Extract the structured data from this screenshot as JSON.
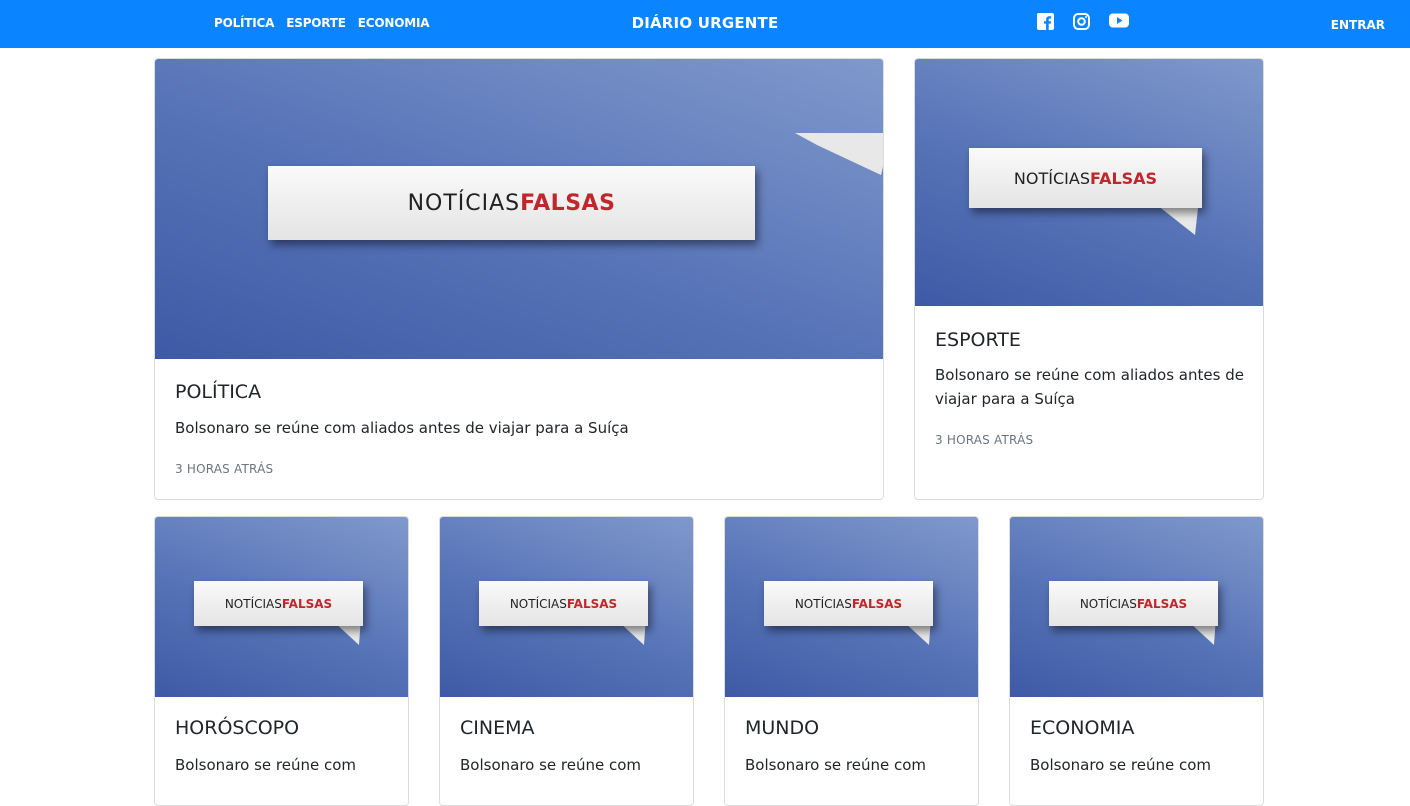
{
  "nav": {
    "links": [
      "POLÍTICA",
      "ESPORTE",
      "ECONOMIA"
    ],
    "brand": "DIÁRIO URGENTE",
    "social": [
      "facebook-icon",
      "instagram-icon",
      "youtube-icon"
    ],
    "login": "ENTRAR"
  },
  "image_text": {
    "part1": "NOTÍCIAS",
    "part2": "FALSAS"
  },
  "colors": {
    "navbar": "#0a85ff",
    "falsas": "#c0272d",
    "card_image_blue": "#4f6db5"
  },
  "cards": [
    {
      "title": "POLÍTICA",
      "text": "Bolsonaro se reúne com aliados antes de viajar para a Suíça",
      "time": "3 HORAS ATRÁS"
    },
    {
      "title": "ESPORTE",
      "text": "Bolsonaro se reúne com aliados antes de viajar para a Suíça",
      "time": "3 HORAS ATRÁS"
    },
    {
      "title": "HORÓSCOPO",
      "text": "Bolsonaro se reúne com"
    },
    {
      "title": "CINEMA",
      "text": "Bolsonaro se reúne com"
    },
    {
      "title": "MUNDO",
      "text": "Bolsonaro se reúne com"
    },
    {
      "title": "ECONOMIA",
      "text": "Bolsonaro se reúne com"
    }
  ]
}
